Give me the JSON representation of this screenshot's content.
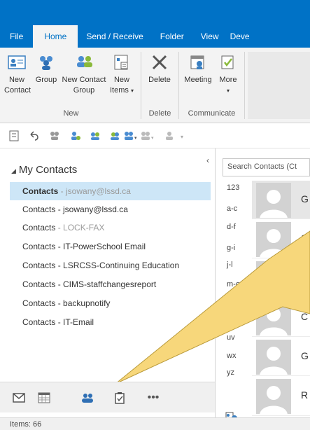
{
  "tabs": [
    {
      "label": "File"
    },
    {
      "label": "Home"
    },
    {
      "label": "Send / Receive"
    },
    {
      "label": "Folder"
    },
    {
      "label": "View"
    },
    {
      "label": "Deve"
    }
  ],
  "ribbon": {
    "new_contact": {
      "line1": "New",
      "line2": "Contact"
    },
    "new_group": {
      "line1": "Group",
      "line2": ""
    },
    "new_contact_group": {
      "line1": "New Contact",
      "line2": "Group"
    },
    "new_items": {
      "line1": "New",
      "line2": "Items"
    },
    "delete": {
      "label": "Delete"
    },
    "meeting": {
      "label": "Meeting"
    },
    "more": {
      "label": "More"
    },
    "groups": {
      "new": "New",
      "delete": "Delete",
      "communicate": "Communicate"
    }
  },
  "folder_pane": {
    "section_title": "My Contacts",
    "items": [
      {
        "name": "Contacts",
        "suffix": " - jsowany@lssd.ca",
        "selected": true
      },
      {
        "name": "Contacts - jsowany@lssd.ca",
        "suffix": ""
      },
      {
        "name": "Contacts",
        "suffix": " - LOCK-FAX"
      },
      {
        "name": "Contacts - IT-PowerSchool Email",
        "suffix": ""
      },
      {
        "name": "Contacts - LSRCSS-Continuing Education",
        "suffix": ""
      },
      {
        "name": "Contacts - CIMS-staffchangesreport",
        "suffix": ""
      },
      {
        "name": "Contacts - backupnotify",
        "suffix": ""
      },
      {
        "name": "Contacts - IT-Email",
        "suffix": ""
      }
    ]
  },
  "search": {
    "placeholder": "Search Contacts (Ct"
  },
  "alpha_index": [
    "123",
    "a-c",
    "d-f",
    "g-i",
    "j-l",
    "m-o",
    "p-",
    "st",
    "uv",
    "wx",
    "yz"
  ],
  "contacts": [
    {
      "initial": "G"
    },
    {
      "initial": "S"
    },
    {
      "initial": "J"
    },
    {
      "initial": "C"
    },
    {
      "initial": "G"
    },
    {
      "initial": "R"
    }
  ],
  "status": {
    "items": "Items: 66"
  },
  "colors": {
    "brand": "#0072c6",
    "selection": "#cde6f7",
    "callout": "#f7d77b"
  }
}
